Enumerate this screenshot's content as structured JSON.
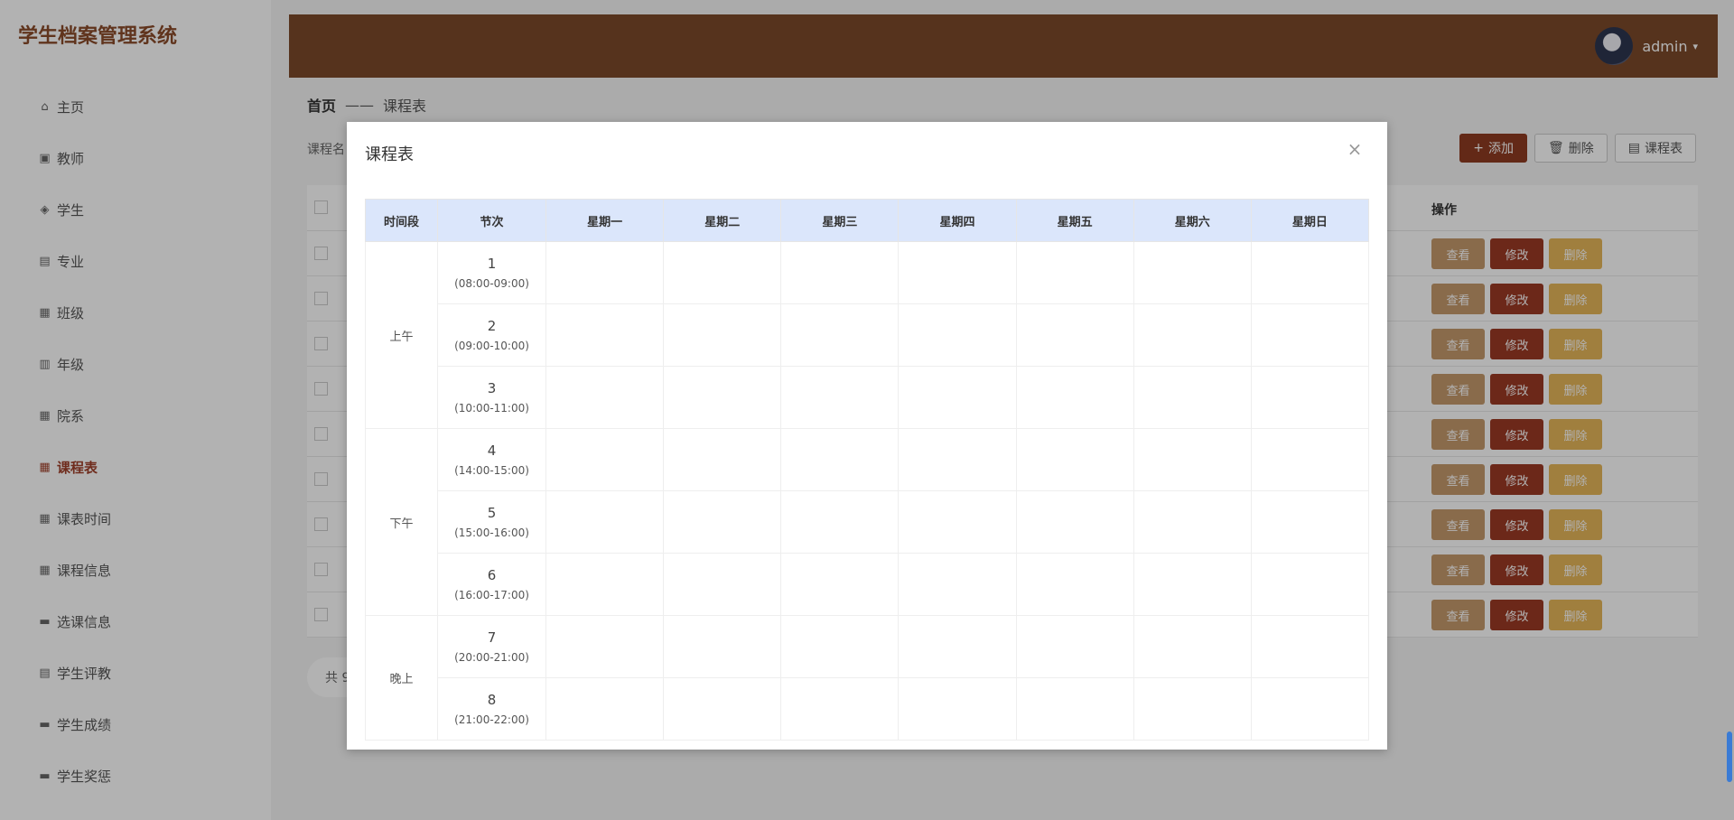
{
  "app": {
    "title": "学生档案管理系统"
  },
  "sidebar": {
    "items": [
      {
        "label": "主页",
        "icon": "home-icon",
        "glyph": "⌂"
      },
      {
        "label": "教师",
        "icon": "teacher-icon",
        "glyph": "▣"
      },
      {
        "label": "学生",
        "icon": "student-icon",
        "glyph": "◈"
      },
      {
        "label": "专业",
        "icon": "major-icon",
        "glyph": "▤"
      },
      {
        "label": "班级",
        "icon": "grid-icon",
        "glyph": "▦"
      },
      {
        "label": "年级",
        "icon": "clipboard-icon",
        "glyph": "▥"
      },
      {
        "label": "院系",
        "icon": "grid-icon",
        "glyph": "▦"
      },
      {
        "label": "课程表",
        "icon": "grid-icon",
        "glyph": "▦",
        "active": true
      },
      {
        "label": "课表时间",
        "icon": "grid-icon",
        "glyph": "▦"
      },
      {
        "label": "课程信息",
        "icon": "grid-icon",
        "glyph": "▦"
      },
      {
        "label": "选课信息",
        "icon": "monitor-icon",
        "glyph": "▬"
      },
      {
        "label": "学生评教",
        "icon": "document-icon",
        "glyph": "▤"
      },
      {
        "label": "学生成绩",
        "icon": "chart-icon",
        "glyph": "▬"
      },
      {
        "label": "学生奖惩",
        "icon": "award-icon",
        "glyph": "▬"
      }
    ]
  },
  "header": {
    "username": "admin",
    "caret": "▾"
  },
  "breadcrumb": {
    "home": "首页",
    "sep": "——",
    "current": "课程表"
  },
  "search": {
    "label": "课程名"
  },
  "toolbar": {
    "add": "添加",
    "delete": "删除",
    "schedule": "课程表",
    "add_glyph": "+",
    "delete_glyph": "🗑",
    "schedule_glyph": "▤"
  },
  "table": {
    "op_header": "操作",
    "row_count": 9,
    "actions": {
      "view": "查看",
      "edit": "修改",
      "del": "删除"
    }
  },
  "pager": {
    "text": "共 9"
  },
  "modal": {
    "title": "课程表",
    "close_glyph": "×",
    "headers": [
      "时间段",
      "节次",
      "星期一",
      "星期二",
      "星期三",
      "星期四",
      "星期五",
      "星期六",
      "星期日"
    ],
    "periods": [
      {
        "label": "上午",
        "slots": [
          {
            "num": "1",
            "time": "(08:00-09:00)"
          },
          {
            "num": "2",
            "time": "(09:00-10:00)"
          },
          {
            "num": "3",
            "time": "(10:00-11:00)"
          }
        ]
      },
      {
        "label": "下午",
        "slots": [
          {
            "num": "4",
            "time": "(14:00-15:00)"
          },
          {
            "num": "5",
            "time": "(15:00-16:00)"
          },
          {
            "num": "6",
            "time": "(16:00-17:00)"
          }
        ]
      },
      {
        "label": "晚上",
        "slots": [
          {
            "num": "7",
            "time": "(20:00-21:00)"
          },
          {
            "num": "8",
            "time": "(21:00-22:00)"
          }
        ]
      }
    ]
  }
}
